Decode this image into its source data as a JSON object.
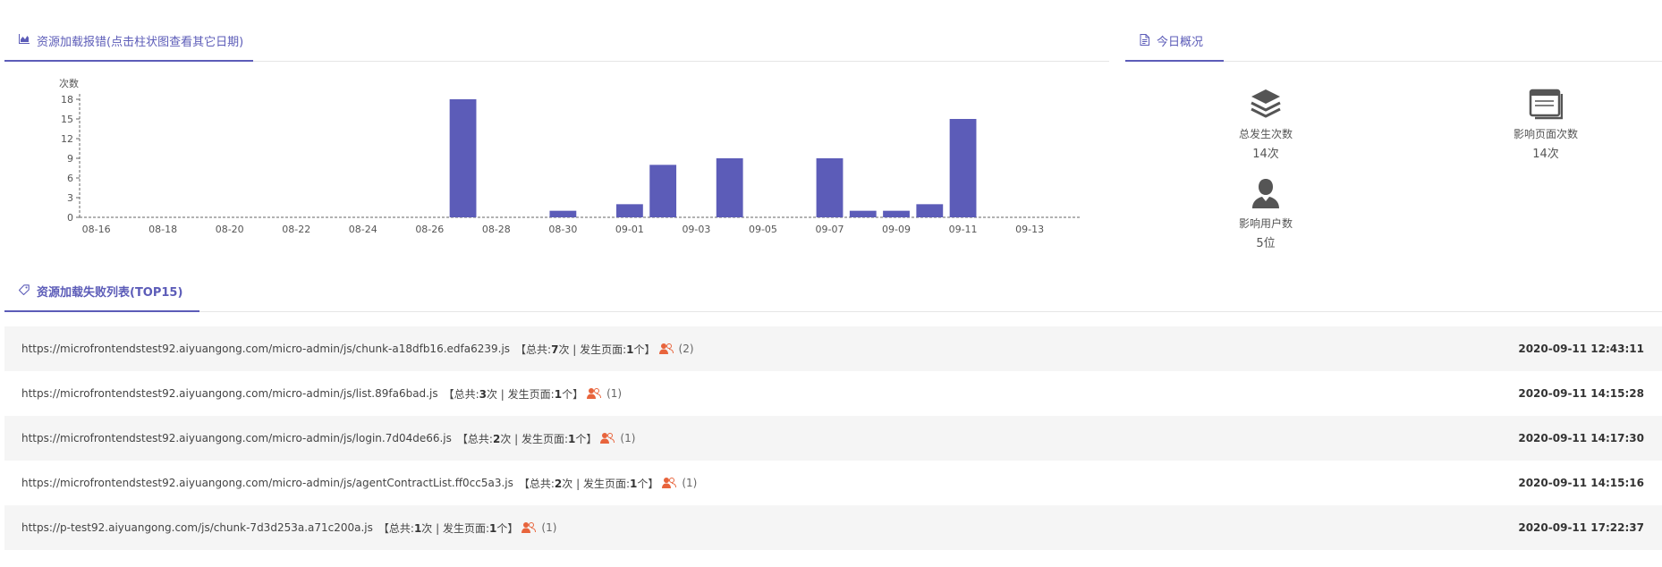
{
  "tabs": {
    "chart_tab": "资源加载报错(点击柱状图查看其它日期)",
    "overview_tab": "今日概况",
    "list_tab": "资源加载失败列表(TOP15)"
  },
  "overview": {
    "total": {
      "label": "总发生次数",
      "value": "14次",
      "icon": "layers-icon"
    },
    "pages": {
      "label": "影响页面次数",
      "value": "14次",
      "icon": "browser-window-icon"
    },
    "users": {
      "label": "影响用户数",
      "value": "5位",
      "icon": "user-icon"
    }
  },
  "chart_data": {
    "type": "bar",
    "ylabel": "次数",
    "ylim": [
      0,
      18
    ],
    "yticks": [
      0,
      3,
      6,
      9,
      12,
      15,
      18
    ],
    "categories": [
      "08-16",
      "08-17",
      "08-18",
      "08-19",
      "08-20",
      "08-21",
      "08-22",
      "08-23",
      "08-24",
      "08-25",
      "08-26",
      "08-27",
      "08-28",
      "08-29",
      "08-30",
      "08-31",
      "09-01",
      "09-02",
      "09-03",
      "09-04",
      "09-05",
      "09-06",
      "09-07",
      "09-08",
      "09-09",
      "09-10",
      "09-11",
      "09-12",
      "09-13",
      "09-14"
    ],
    "xticks": [
      "08-16",
      "08-18",
      "08-20",
      "08-22",
      "08-24",
      "08-26",
      "08-28",
      "08-30",
      "09-01",
      "09-03",
      "09-05",
      "09-07",
      "09-09",
      "09-11",
      "09-13"
    ],
    "values": [
      0,
      0,
      0,
      0,
      0,
      0,
      0,
      0,
      0,
      0,
      0,
      18,
      0,
      0,
      1,
      0,
      2,
      8,
      0,
      9,
      0,
      0,
      9,
      1,
      1,
      2,
      15,
      0,
      0,
      0
    ],
    "bar_color": "#5c5cb8",
    "grid": false
  },
  "failures": [
    {
      "url": "https://microfrontendstest92.aiyuangong.com/micro-admin/js/chunk-a18dfb16.edfa6239.js",
      "total_label": "【总共:",
      "total": "7",
      "times_unit": "次 | 发生页面:",
      "pages": "1",
      "pages_unit": "个】",
      "users": "(2)",
      "time": "2020-09-11 12:43:11"
    },
    {
      "url": "https://microfrontendstest92.aiyuangong.com/micro-admin/js/list.89fa6bad.js",
      "total_label": "【总共:",
      "total": "3",
      "times_unit": "次 | 发生页面:",
      "pages": "1",
      "pages_unit": "个】",
      "users": "(1)",
      "time": "2020-09-11 14:15:28"
    },
    {
      "url": "https://microfrontendstest92.aiyuangong.com/micro-admin/js/login.7d04de66.js",
      "total_label": "【总共:",
      "total": "2",
      "times_unit": "次 | 发生页面:",
      "pages": "1",
      "pages_unit": "个】",
      "users": "(1)",
      "time": "2020-09-11 14:17:30"
    },
    {
      "url": "https://microfrontendstest92.aiyuangong.com/micro-admin/js/agentContractList.ff0cc5a3.js",
      "total_label": "【总共:",
      "total": "2",
      "times_unit": "次 | 发生页面:",
      "pages": "1",
      "pages_unit": "个】",
      "users": "(1)",
      "time": "2020-09-11 14:15:16"
    },
    {
      "url": "https://p-test92.aiyuangong.com/js/chunk-7d3d253a.a71c200a.js",
      "total_label": "【总共:",
      "total": "1",
      "times_unit": "次 | 发生页面:",
      "pages": "1",
      "pages_unit": "个】",
      "users": "(1)",
      "time": "2020-09-11 17:22:37"
    }
  ],
  "colors": {
    "accent": "#5c5cb8",
    "users_icon": "#e8643c",
    "row_bg": "#f5f5f5"
  }
}
